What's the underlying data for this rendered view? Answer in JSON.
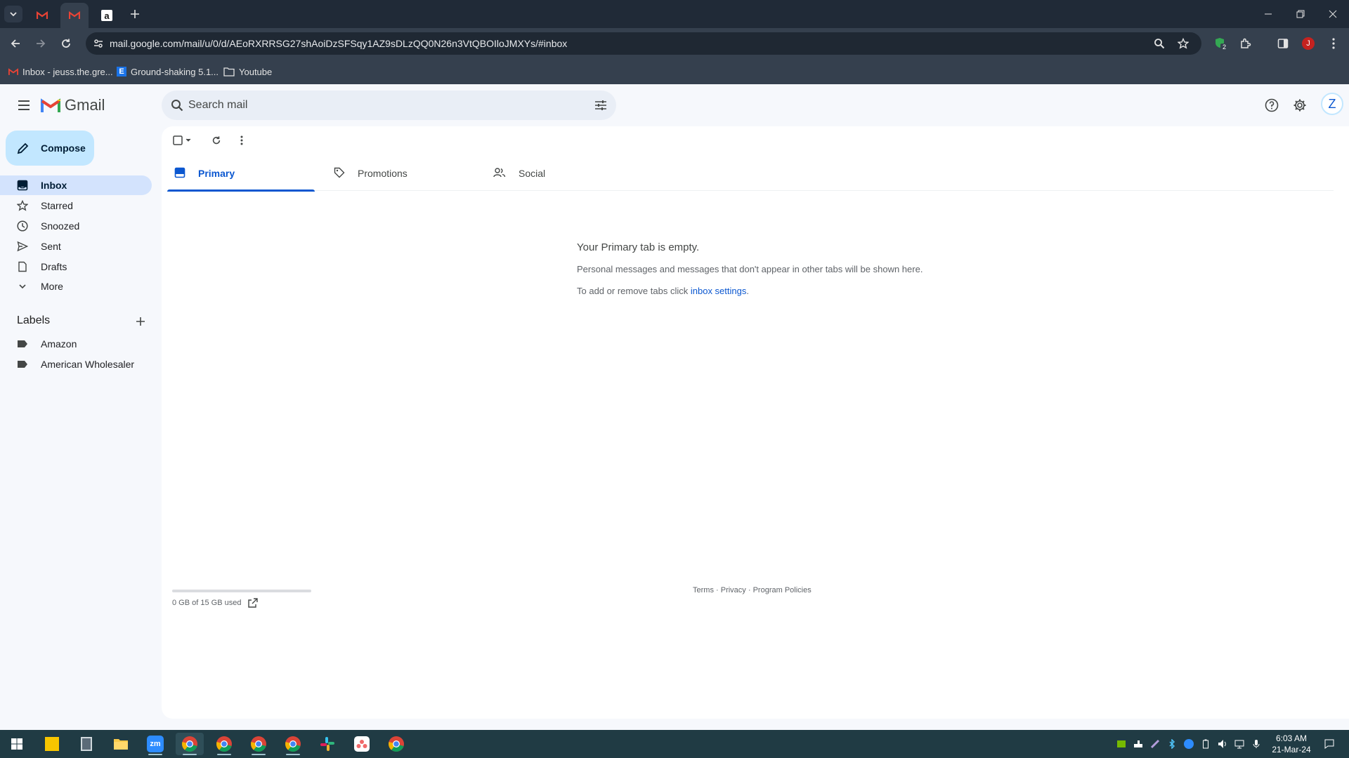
{
  "browser": {
    "url": "mail.google.com/mail/u/0/d/AEoRXRRSG27shAoiDzSFSqy1AZ9sDLzQQ0N26n3VtQBOIloJMXYs/#inbox",
    "profile_initial": "J",
    "extension_badge": "2"
  },
  "bookmarks": [
    {
      "label": "Inbox - jeuss.the.gre..."
    },
    {
      "label": "Ground-shaking 5.1..."
    },
    {
      "label": "Youtube"
    }
  ],
  "gmail": {
    "logo_text": "Gmail",
    "search_placeholder": "Search mail",
    "account_initial": "Z",
    "compose_label": "Compose",
    "nav": [
      {
        "label": "Inbox",
        "icon": "inbox-icon"
      },
      {
        "label": "Starred",
        "icon": "star-icon"
      },
      {
        "label": "Snoozed",
        "icon": "clock-icon"
      },
      {
        "label": "Sent",
        "icon": "send-icon"
      },
      {
        "label": "Drafts",
        "icon": "draft-icon"
      },
      {
        "label": "More",
        "icon": "chevron-down-icon"
      }
    ],
    "labels_title": "Labels",
    "labels": [
      {
        "label": "Amazon"
      },
      {
        "label": "American Wholesaler"
      }
    ],
    "tabs": [
      {
        "label": "Primary",
        "icon": "inbox-icon",
        "selected": true
      },
      {
        "label": "Promotions",
        "icon": "tag-icon",
        "selected": false
      },
      {
        "label": "Social",
        "icon": "people-icon",
        "selected": false
      }
    ],
    "empty": {
      "title": "Your Primary tab is empty.",
      "line1": "Personal messages and messages that don't appear in other tabs will be shown here.",
      "line2_prefix": "To add or remove tabs click ",
      "line2_link": "inbox settings",
      "line2_suffix": "."
    },
    "storage": {
      "text": "0 GB of 15 GB used",
      "fraction_used": 0
    },
    "footer": {
      "terms": "Terms",
      "privacy": "Privacy",
      "policies": "Program Policies",
      "separator": " · "
    }
  },
  "taskbar": {
    "time": "6:03 AM",
    "date": "21-Mar-24",
    "zoom_label": "zm"
  },
  "colors": {
    "accent": "#0b57d0",
    "compose_bg": "#c2e7ff",
    "nav_active_bg": "#d3e3fd",
    "titlebar": "#202a37",
    "taskbar": "#203b44"
  }
}
